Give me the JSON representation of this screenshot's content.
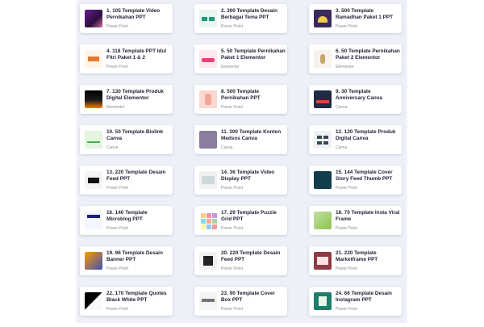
{
  "products": [
    {
      "title": "1. 105 Template Video Pernikahan PPT",
      "category": "Power Point",
      "thumb": "video-wedding-thumbnail"
    },
    {
      "title": "2. 300 Template Desain Berbagai Tema PPT",
      "category": "Power Point",
      "thumb": "multi-theme-thumbnail"
    },
    {
      "title": "3. 500 Template Ramadhan Paket 1 PPT",
      "category": "Power Point",
      "thumb": "ramadhan-thumbnail"
    },
    {
      "title": "4. 118 Template PPT Idul Fitri Paket 1 & 2",
      "category": "Power Point",
      "thumb": "idul-fitri-thumbnail"
    },
    {
      "title": "5. 50 Template Pernikahan Paket 1 Elementor",
      "category": "Elementor",
      "thumb": "wedding-elementor-thumbnail"
    },
    {
      "title": "6. 50 Template Pernikahan Paket 2 Elementor",
      "category": "Elementor",
      "thumb": "wedding-elementor-2-thumbnail"
    },
    {
      "title": "7. 130 Template Produk Digital Elementor",
      "category": "Elementor",
      "thumb": "digital-product-thumbnail"
    },
    {
      "title": "8. 500 Template Pernikahan PPT",
      "category": "Power Point",
      "thumb": "wedding-ppt-thumbnail"
    },
    {
      "title": "9. 30 Template Anniversary Canva",
      "category": "Canva",
      "thumb": "anniversary-thumbnail"
    },
    {
      "title": "10. 50 Template Biolink Canva",
      "category": "Canva",
      "thumb": "biolink-thumbnail"
    },
    {
      "title": "11. 300 Template Konten Medsos Canva",
      "category": "Canva",
      "thumb": "social-media-thumbnail"
    },
    {
      "title": "12. 120 Template Produk Digital Canva",
      "category": "Canva",
      "thumb": "digital-product-canva-thumbnail"
    },
    {
      "title": "13. 220 Template Desain Feed PPT",
      "category": "Power Point",
      "thumb": "feed-design-thumbnail"
    },
    {
      "title": "14. 36 Template Video Display PPT",
      "category": "Power Point",
      "thumb": "video-display-thumbnail"
    },
    {
      "title": "15. 144 Template Cover Story Feed Thumb PPT",
      "category": "Power Point",
      "thumb": "cover-story-thumbnail"
    },
    {
      "title": "16. 140 Template Microblog PPT",
      "category": "Power Point",
      "thumb": "microblog-thumbnail"
    },
    {
      "title": "17. 29 Template Puzzle Grid PPT",
      "category": "Power Point",
      "thumb": "puzzle-grid-thumbnail"
    },
    {
      "title": "18. 70 Template Insta Viral Frame",
      "category": "Power Point",
      "thumb": "insta-frame-thumbnail"
    },
    {
      "title": "19. 96 Template Desain Banner PPT",
      "category": "Power Point",
      "thumb": "banner-thumbnail"
    },
    {
      "title": "20. 220 Template Desain Feed PPT",
      "category": "Power Point",
      "thumb": "feed-design-2-thumbnail"
    },
    {
      "title": "21. 220 Template Marketframe PPT",
      "category": "Power Point",
      "thumb": "marketframe-thumbnail"
    },
    {
      "title": "22. 170 Template Quotes Black White PPT",
      "category": "Power Point",
      "thumb": "quotes-thumbnail"
    },
    {
      "title": "23. 90 Template Cover Box PPT",
      "category": "Power Point",
      "thumb": "cover-box-thumbnail"
    },
    {
      "title": "24. 66 Template Desain Instagram PPT",
      "category": "Power Point",
      "thumb": "instagram-thumbnail"
    }
  ]
}
